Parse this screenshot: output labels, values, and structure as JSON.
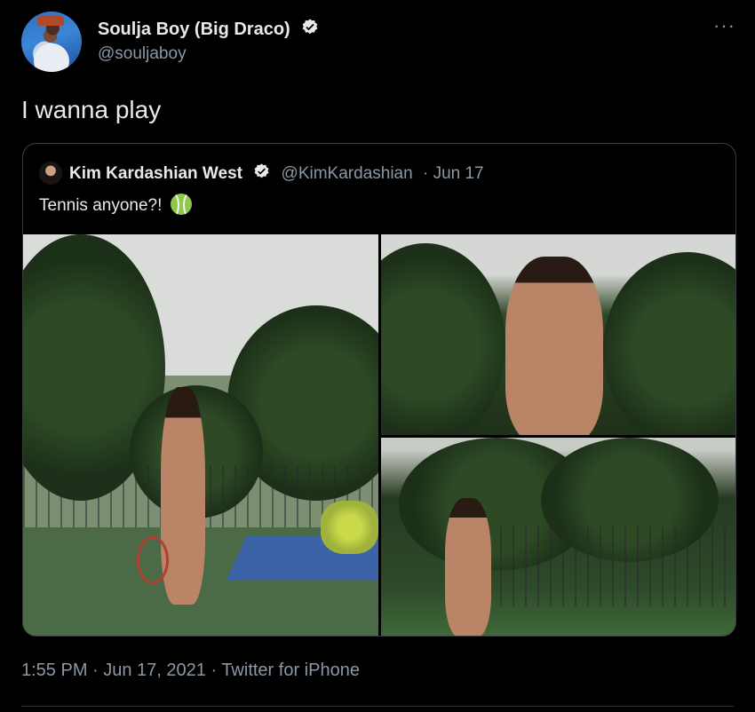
{
  "author": {
    "display_name": "Soulja Boy (Big Draco)",
    "handle": "@souljaboy",
    "verified": true
  },
  "more_icon": "···",
  "tweet": {
    "text": "I wanna play",
    "footer": "1:55 PM · Jun 17, 2021 · Twitter for iPhone"
  },
  "quoted": {
    "display_name": "Kim Kardashian West",
    "handle": "@KimKardashian",
    "date": "· Jun 17",
    "text": "Tennis anyone?!",
    "emoji": "tennis-ball-icon"
  },
  "colors": {
    "background": "#000000",
    "text_primary": "#e7e9ea",
    "text_secondary": "#8b98a5",
    "border": "#3a3f44"
  }
}
